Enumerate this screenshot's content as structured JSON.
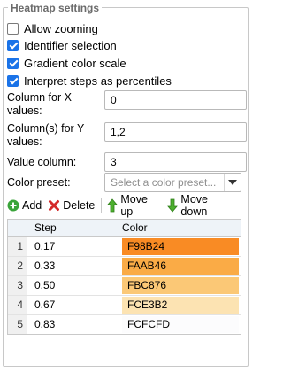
{
  "panel": {
    "title": "Heatmap settings"
  },
  "options": [
    {
      "label": "Allow zooming",
      "checked": false
    },
    {
      "label": "Identifier selection",
      "checked": true
    },
    {
      "label": "Gradient color scale",
      "checked": true
    },
    {
      "label": "Interpret steps as percentiles",
      "checked": true
    }
  ],
  "fields": {
    "x_column": {
      "label": "Column for X values:",
      "value": "0"
    },
    "y_columns": {
      "label": "Column(s) for Y values:",
      "value": "1,2"
    },
    "value_column": {
      "label": "Value column:",
      "value": "3"
    },
    "color_preset": {
      "label": "Color preset:",
      "placeholder": "Select a color preset..."
    }
  },
  "toolbar": {
    "add_label": "Add",
    "delete_label": "Delete",
    "move_up_label": "Move up",
    "move_down_label": "Move down"
  },
  "grid": {
    "headers": {
      "step": "Step",
      "color": "Color"
    },
    "rows": [
      {
        "num": "1",
        "step": "0.17",
        "color": "F98B24",
        "bg": "#F98B24"
      },
      {
        "num": "2",
        "step": "0.33",
        "color": "FAAB46",
        "bg": "#FAAB46"
      },
      {
        "num": "3",
        "step": "0.50",
        "color": "FBC876",
        "bg": "#FBC876"
      },
      {
        "num": "4",
        "step": "0.67",
        "color": "FCE3B2",
        "bg": "#FCE3B2"
      },
      {
        "num": "5",
        "step": "0.83",
        "color": "FCFCFD",
        "bg": "#FCFCFD"
      }
    ]
  },
  "colors": {
    "add_icon": "#3aa43a",
    "delete_icon": "#d42a2a",
    "arrow_icon": "#4caf2e",
    "header_bg": "#eef3f8"
  }
}
